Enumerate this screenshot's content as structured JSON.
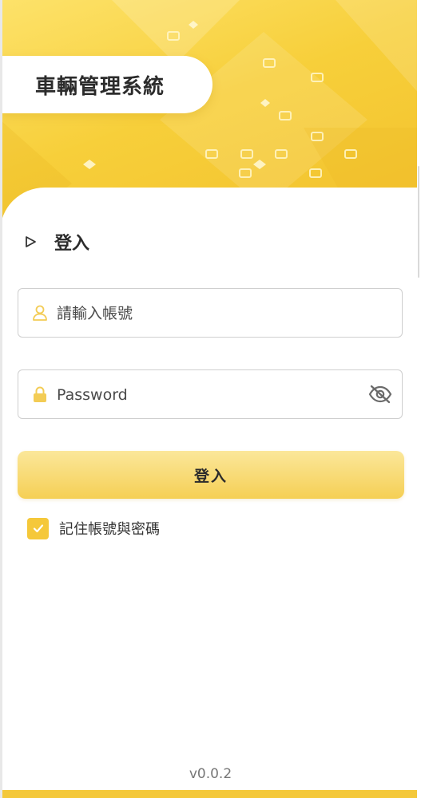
{
  "app": {
    "title": "車輛管理系統",
    "version": "v0.0.2"
  },
  "login": {
    "heading": "登入",
    "username": {
      "placeholder": "請輸入帳號",
      "value": ""
    },
    "password": {
      "placeholder": "Password",
      "value": ""
    },
    "submit_label": "登入",
    "remember_label": "記住帳號與密碼",
    "remember_checked": true
  },
  "colors": {
    "accent": "#f5c83a",
    "accent_light": "#fbe79a",
    "icon": "#f7d76a"
  }
}
